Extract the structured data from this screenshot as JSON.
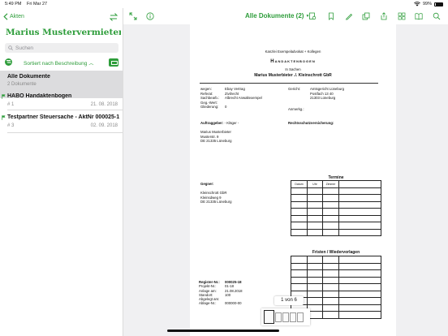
{
  "status": {
    "time": "5:49 PM",
    "date": "Fri Mar 27",
    "battery": "99%"
  },
  "sidebar": {
    "back_label": "Akten",
    "title": "Marius Mustervermieter ./. Kleinschrott GbR",
    "search_placeholder": "Suchen",
    "sort_label": "Sortiert nach Beschreibung",
    "items": [
      {
        "title": "Alle Dokumente",
        "subtitle": "2 Dokumente"
      },
      {
        "title": "HABO Handaktenbogen",
        "number": "# 1",
        "date": "21. 08. 2018"
      },
      {
        "title": "Testpartner Steuersache - AktNr 000025-18",
        "number": "# 3",
        "date": "02. 09. 2018"
      }
    ]
  },
  "toolbar": {
    "doc_title": "Alle Dokumente (2)"
  },
  "document": {
    "firm": "Kanzlei Exempeladvokat + Kollegen",
    "heading": "Handaktenbogen",
    "in_sachen": "In Sachen",
    "parties": "Marius Musterbieter ./. Kleinschrott GbR",
    "left_labels": [
      "wegen:",
      "Referat:",
      "Sachbearb.:",
      "Geg.-Wert:",
      "Gliederung:"
    ],
    "left_values": [
      "Ebay Vertrag",
      "Zivilrecht",
      "Albrecht Anwaltexempel",
      "",
      "0"
    ],
    "gericht_label": "Gericht:",
    "gericht_lines": [
      "Amtsgericht Lüneburg",
      "Postfach 13 40",
      "21303 Lüneburg"
    ],
    "anmerk_label": "Anmerkg.:",
    "auftrag_label": "Auftraggeber:",
    "auftrag_role": "- Kläger -",
    "rechtsschutz_label": "Rechtsschutzversicherung:",
    "auftrag_address": [
      "Marius Musterbieter",
      "Musterstr. 9",
      "DE 21335 Lüneburg"
    ],
    "gegner_label": "Gegner:",
    "gegner_address": [
      "Kleinschrott GbR",
      "Kleinsdweg 9",
      "DE 21335 Lüneburg"
    ],
    "termine_title": "Termine",
    "termine_headers": [
      "Datum",
      "Uhr",
      "Zimmer",
      ""
    ],
    "fristen_title": "Fristen / Wiedervorlagen",
    "register_labels": [
      "Register-Nr.:",
      "Projekt-Nr.:",
      "Anlage am:",
      "Standort:",
      "Abgelegt am:",
      "Ablage-Nr.:"
    ],
    "register_values": [
      "000025-18",
      "01-18",
      "21.08.2018",
      "100",
      "",
      "000000-00"
    ]
  },
  "pager": {
    "label": "1 von 6"
  }
}
